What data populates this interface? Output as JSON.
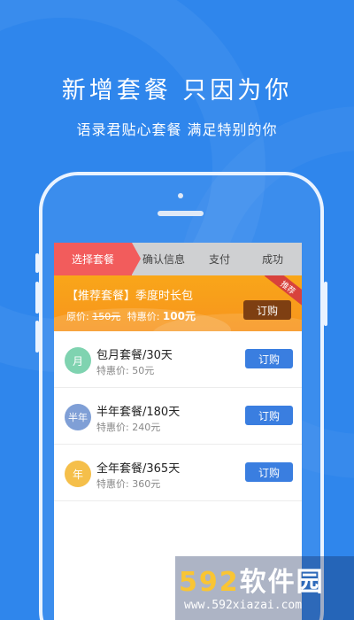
{
  "headline": "新增套餐 只因为你",
  "subline": "语录君贴心套餐  满足特别的你",
  "steps": [
    "选择套餐",
    "确认信息",
    "支付",
    "成功"
  ],
  "promo": {
    "title": "【推荐套餐】季度时长包",
    "orig_label": "原价: ",
    "orig_price": "150元",
    "sale_label": "特惠价: ",
    "sale_price": "100元",
    "button": "订购",
    "ribbon": "推荐"
  },
  "plans": [
    {
      "icon": "月",
      "name": "包月套餐/30天",
      "price": "特惠价: 50元",
      "button": "订购",
      "color": "#7fd3b0"
    },
    {
      "icon": "半年",
      "name": "半年套餐/180天",
      "price": "特惠价: 240元",
      "button": "订购",
      "color": "#7f9fd6"
    },
    {
      "icon": "年",
      "name": "全年套餐/365天",
      "price": "特惠价: 360元",
      "button": "订购",
      "color": "#f5bf4a"
    }
  ],
  "watermark": {
    "digits": "592",
    "text": "软件园",
    "url": "www.592xiazai.com"
  }
}
